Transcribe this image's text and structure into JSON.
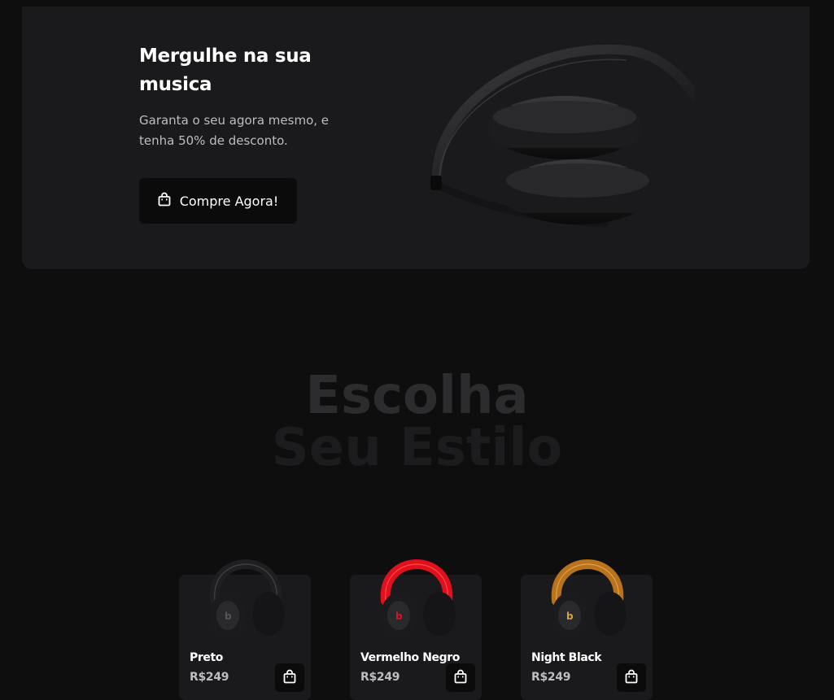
{
  "hero": {
    "title": "Mergulhe na sua musica",
    "description": "Garanta o seu agora mesmo, e tenha 50% de desconto.",
    "cta_label": "Compre Agora!",
    "cta_icon": "shopping-bag-icon"
  },
  "styles_section": {
    "title_line1": "Escolha",
    "title_line2": "Seu Estilo"
  },
  "products": [
    {
      "name": "Preto",
      "price": "R$249",
      "accent": "#2a2a2e",
      "cart_icon": "shopping-bag-icon"
    },
    {
      "name": "Vermelho Negro",
      "price": "R$249",
      "accent": "#e0101c",
      "cart_icon": "shopping-bag-icon"
    },
    {
      "name": "Night Black",
      "price": "R$249",
      "accent": "#b8731c",
      "cart_icon": "shopping-bag-icon"
    }
  ],
  "colors": {
    "page_bg": "#0e0e0f",
    "card_bg": "#1a1a1d",
    "button_bg": "#0b0b0c"
  }
}
